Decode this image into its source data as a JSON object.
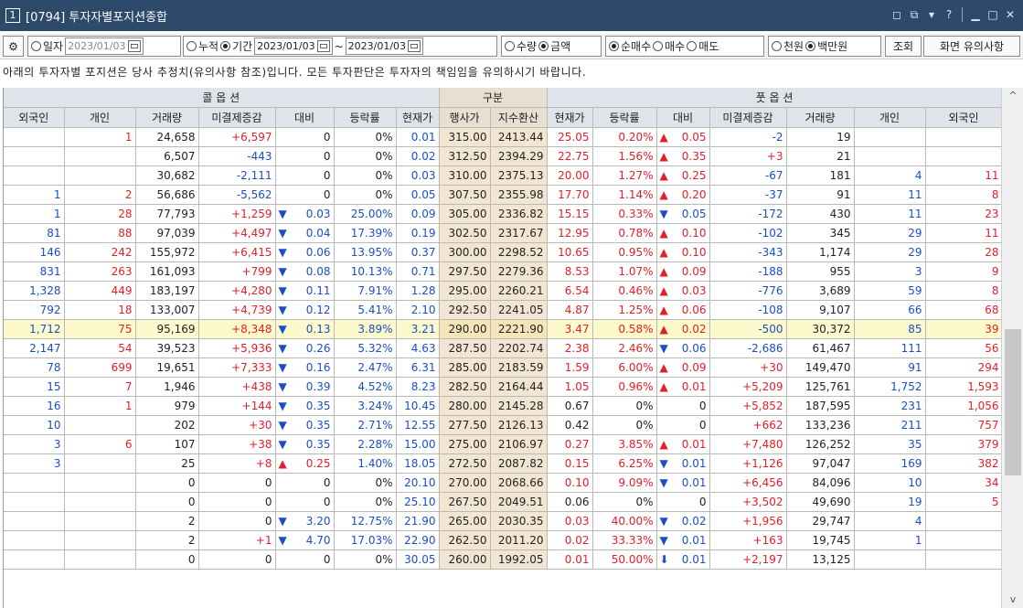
{
  "window": {
    "number": "1",
    "title": "[0794] 투자자별포지션종합",
    "buttons": [
      "◻",
      "⧉",
      "▾",
      "?",
      "▁",
      "□",
      "✕"
    ]
  },
  "toolbar": {
    "gear": "⚙",
    "r_day": "일자",
    "date_single": "2023/01/03",
    "r_cumul": "누적",
    "r_period": "기간",
    "date_from": "2023/01/03",
    "tilde": "~",
    "date_to": "2023/01/03",
    "r_qty": "수량",
    "r_amount": "금액",
    "r_netbuy": "순매수",
    "r_buy": "매수",
    "r_sell": "매도",
    "r_won1000": "천원",
    "r_million": "백만원",
    "btn_query": "조회",
    "btn_notes": "화면 유의사항"
  },
  "notice": "아래의 투자자별 포지션은 당사 추정치(유의사항 참조)입니다. 모든 투자판단은 투자자의 책임임을 유의하시기 바랍니다.",
  "header": {
    "call": "콜 옵 션",
    "div": "구분",
    "put": "풋 옵 션",
    "cols": [
      "외국인",
      "개인",
      "거래량",
      "미결제증감",
      "대비",
      "등락률",
      "현재가",
      "행사가",
      "지수환산",
      "현재가",
      "등락률",
      "대비",
      "미결제증감",
      "거래량",
      "개인",
      "외국인"
    ]
  },
  "rows": [
    [
      "",
      "1",
      "24,658",
      "+6,597",
      "0",
      "0%",
      "0.01",
      "315.00",
      "2413.44",
      "25.05",
      "0.20%",
      "▲0.05",
      "-2",
      "19",
      "",
      ""
    ],
    [
      "",
      "",
      "6,507",
      "-443",
      "0",
      "0%",
      "0.02",
      "312.50",
      "2394.29",
      "22.75",
      "1.56%",
      "▲0.35",
      "+3",
      "21",
      "",
      ""
    ],
    [
      "",
      "",
      "30,682",
      "-2,111",
      "0",
      "0%",
      "0.03",
      "310.00",
      "2375.13",
      "20.00",
      "1.27%",
      "▲0.25",
      "-67",
      "181",
      "4",
      "11"
    ],
    [
      "1",
      "2",
      "56,686",
      "-5,562",
      "0",
      "0%",
      "0.05",
      "307.50",
      "2355.98",
      "17.70",
      "1.14%",
      "▲0.20",
      "-37",
      "91",
      "11",
      "8"
    ],
    [
      "1",
      "28",
      "77,793",
      "+1,259",
      "▼0.03",
      "25.00%",
      "0.09",
      "305.00",
      "2336.82",
      "15.15",
      "0.33%",
      "▼0.05",
      "-172",
      "430",
      "11",
      "23"
    ],
    [
      "81",
      "88",
      "97,039",
      "+4,497",
      "▼0.04",
      "17.39%",
      "0.19",
      "302.50",
      "2317.67",
      "12.95",
      "0.78%",
      "▲0.10",
      "-102",
      "345",
      "29",
      "11"
    ],
    [
      "146",
      "242",
      "155,972",
      "+6,415",
      "▼0.06",
      "13.95%",
      "0.37",
      "300.00",
      "2298.52",
      "10.65",
      "0.95%",
      "▲0.10",
      "-343",
      "1,174",
      "29",
      "28"
    ],
    [
      "831",
      "263",
      "161,093",
      "+799",
      "▼0.08",
      "10.13%",
      "0.71",
      "297.50",
      "2279.36",
      "8.53",
      "1.07%",
      "▲0.09",
      "-188",
      "955",
      "3",
      "9"
    ],
    [
      "1,328",
      "449",
      "183,197",
      "+4,280",
      "▼0.11",
      "7.91%",
      "1.28",
      "295.00",
      "2260.21",
      "6.54",
      "0.46%",
      "▲0.03",
      "-776",
      "3,689",
      "59",
      "8"
    ],
    [
      "792",
      "18",
      "133,007",
      "+4,739",
      "▼0.12",
      "5.41%",
      "2.10",
      "292.50",
      "2241.05",
      "4.87",
      "1.25%",
      "▲0.06",
      "-108",
      "9,107",
      "66",
      "68"
    ],
    [
      "1,712",
      "75",
      "95,169",
      "+8,348",
      "▼0.13",
      "3.89%",
      "3.21",
      "290.00",
      "2221.90",
      "3.47",
      "0.58%",
      "▲0.02",
      "-500",
      "30,372",
      "85",
      "39"
    ],
    [
      "2,147",
      "54",
      "39,523",
      "+5,936",
      "▼0.26",
      "5.32%",
      "4.63",
      "287.50",
      "2202.74",
      "2.38",
      "2.46%",
      "▼0.06",
      "-2,686",
      "61,467",
      "111",
      "56"
    ],
    [
      "78",
      "699",
      "19,651",
      "+7,333",
      "▼0.16",
      "2.47%",
      "6.31",
      "285.00",
      "2183.59",
      "1.59",
      "6.00%",
      "▲0.09",
      "+30",
      "149,470",
      "91",
      "294"
    ],
    [
      "15",
      "7",
      "1,946",
      "+438",
      "▼0.39",
      "4.52%",
      "8.23",
      "282.50",
      "2164.44",
      "1.05",
      "0.96%",
      "▲0.01",
      "+5,209",
      "125,761",
      "1,752",
      "1,593"
    ],
    [
      "16",
      "1",
      "979",
      "+144",
      "▼0.35",
      "3.24%",
      "10.45",
      "280.00",
      "2145.28",
      "0.67",
      "0%",
      "0",
      "+5,852",
      "187,595",
      "231",
      "1,056"
    ],
    [
      "10",
      "",
      "202",
      "+30",
      "▼0.35",
      "2.71%",
      "12.55",
      "277.50",
      "2126.13",
      "0.42",
      "0%",
      "0",
      "+662",
      "133,236",
      "211",
      "757"
    ],
    [
      "3",
      "6",
      "107",
      "+38",
      "▼0.35",
      "2.28%",
      "15.00",
      "275.00",
      "2106.97",
      "0.27",
      "3.85%",
      "▲0.01",
      "+7,480",
      "126,252",
      "35",
      "379"
    ],
    [
      "3",
      "",
      "25",
      "+8",
      "▲0.25",
      "1.40%",
      "18.05",
      "272.50",
      "2087.82",
      "0.15",
      "6.25%",
      "▼0.01",
      "+1,126",
      "97,047",
      "169",
      "382"
    ],
    [
      "",
      "",
      "0",
      "0",
      "0",
      "0%",
      "20.10",
      "270.00",
      "2068.66",
      "0.10",
      "9.09%",
      "▼0.01",
      "+6,456",
      "84,096",
      "10",
      "34"
    ],
    [
      "",
      "",
      "0",
      "0",
      "0",
      "0%",
      "25.10",
      "267.50",
      "2049.51",
      "0.06",
      "0%",
      "0",
      "+3,502",
      "49,690",
      "19",
      "5"
    ],
    [
      "",
      "",
      "2",
      "0",
      "▼3.20",
      "12.75%",
      "21.90",
      "265.00",
      "2030.35",
      "0.03",
      "40.00%",
      "▼0.02",
      "+1,956",
      "29,747",
      "4",
      ""
    ],
    [
      "",
      "",
      "2",
      "+1",
      "▼4.70",
      "17.03%",
      "22.90",
      "262.50",
      "2011.20",
      "0.02",
      "33.33%",
      "▼0.01",
      "+163",
      "19,745",
      "1",
      ""
    ],
    [
      "",
      "",
      "0",
      "0",
      "0",
      "0%",
      "30.05",
      "260.00",
      "1992.05",
      "0.01",
      "50.00%",
      "⬇0.01",
      "+2,197",
      "13,125",
      "",
      ""
    ]
  ],
  "highlight_row": 10,
  "colors": {
    "up": "#e0202a",
    "down": "#1a4fc4",
    "title": "#2d4a6b",
    "highlight": "#fdf9cc",
    "strike": "#f2e6d2"
  }
}
